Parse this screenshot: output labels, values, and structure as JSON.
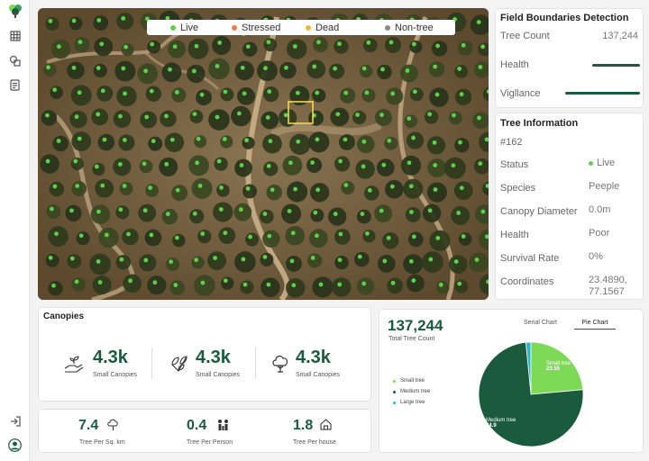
{
  "colors": {
    "brand": "#1a5b3d",
    "live": "#7ed957",
    "stressed": "#f07a45",
    "dead": "#f2b33d",
    "non_tree": "#8a8a8a"
  },
  "legend": [
    {
      "label": "Live",
      "color": "#5bd14c"
    },
    {
      "label": "Stressed",
      "color": "#f07a45"
    },
    {
      "label": "Dead",
      "color": "#f2b33d"
    },
    {
      "label": "Non-tree",
      "color": "#8a8a8a"
    }
  ],
  "boundaries": {
    "title": "Field Boundaries Detection",
    "tree_count_label": "Tree Count",
    "tree_count_value": "137,244",
    "health_label": "Health",
    "health_level": 0.74,
    "vigilance_label": "Vigllance",
    "vigilance_level": 0.9
  },
  "tree_info": {
    "title": "Tree Information",
    "id": "#162",
    "rows": [
      {
        "label": "Status",
        "value": "Live"
      },
      {
        "label": "Species",
        "value": "Peeple"
      },
      {
        "label": "Canopy Diameter",
        "value": "0.0m"
      },
      {
        "label": "Health",
        "value": "Poor"
      },
      {
        "label": "Survival Rate",
        "value": "0%"
      },
      {
        "label": "Coordinates",
        "value": "23.4890, 77.1567"
      }
    ]
  },
  "canopies": {
    "title": "Canopies",
    "items": [
      {
        "value": "4.3k",
        "label": "Small Canopies",
        "icon": "hand-sprout-icon"
      },
      {
        "value": "4.3k",
        "label": "Small Canopies",
        "icon": "leaves-icon"
      },
      {
        "value": "4.3k",
        "label": "Small Canopies",
        "icon": "tree-icon"
      }
    ]
  },
  "density": [
    {
      "value": "7.4",
      "label": "Tree Per Sq. km",
      "icon": "tree-outline-icon"
    },
    {
      "value": "0.4",
      "label": "Tree Per Person",
      "icon": "people-icon"
    },
    {
      "value": "1.8",
      "label": "Tree Per house",
      "icon": "house-icon"
    }
  ],
  "total": {
    "value": "137,244",
    "label": "Total Tree Count",
    "tabs": [
      "Serial Chart",
      "Pie Chart"
    ],
    "active_tab": "Pie Chart"
  },
  "chart_data": {
    "type": "pie",
    "title": "",
    "slices": [
      {
        "name": "Small tree",
        "value": 23.55,
        "color": "#7ed957"
      },
      {
        "name": "Medium tree",
        "value": 74.9,
        "color": "#1a5b3d"
      },
      {
        "name": "Large tree",
        "value": 1.55,
        "color": "#29b6c8"
      }
    ],
    "legend_position": "left"
  }
}
